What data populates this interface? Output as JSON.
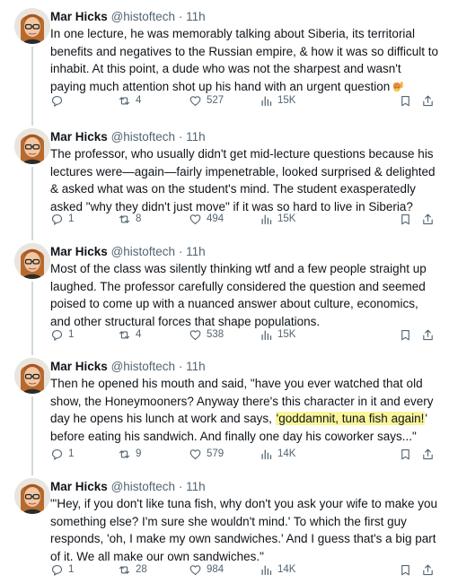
{
  "tweets": [
    {
      "author": {
        "name": "Mar Hicks",
        "handle": "@histoftech",
        "separator": "·",
        "time": "11h"
      },
      "text_parts": [
        "In one lecture, he was memorably talking about Siberia, its territorial benefits and negatives to the Russian empire, & how it was so difficult to inhabit. At this point, a dude who was not the sharpest and wasn't paying much attention shot up his hand with an urgent question"
      ],
      "emoji": "raising-hand-emoji",
      "stats": {
        "replies": "",
        "retweets": "4",
        "likes": "527",
        "views": "15K"
      }
    },
    {
      "author": {
        "name": "Mar Hicks",
        "handle": "@histoftech",
        "separator": "·",
        "time": "11h"
      },
      "text_parts": [
        "The professor, who usually didn't get mid-lecture questions because his lectures were—again—fairly impenetrable, looked surprised & delighted & asked what was on the student's mind. The student exasperatedly asked \"why they didn't just move\" if it was so hard to live in Siberia?"
      ],
      "stats": {
        "replies": "1",
        "retweets": "8",
        "likes": "494",
        "views": "15K"
      }
    },
    {
      "author": {
        "name": "Mar Hicks",
        "handle": "@histoftech",
        "separator": "·",
        "time": "11h"
      },
      "text_parts": [
        "Most of the class was silently thinking wtf and a few people straight up laughed. The professor carefully considered the question and seemed poised to come up with a nuanced answer about culture, economics, and other structural forces that shape populations."
      ],
      "stats": {
        "replies": "1",
        "retweets": "4",
        "likes": "538",
        "views": "15K"
      }
    },
    {
      "author": {
        "name": "Mar Hicks",
        "handle": "@histoftech",
        "separator": "·",
        "time": "11h"
      },
      "text_parts": [
        "Then he opened his mouth and said, \"have you ever watched that old show, the Honeymooners? Anyway there's this character in it and every day he opens his lunch at work and says, ",
        "'goddamnit, tuna fish again!",
        "' before eating his sandwich. And finally one day his coworker says...\""
      ],
      "stats": {
        "replies": "1",
        "retweets": "9",
        "likes": "579",
        "views": "14K"
      }
    },
    {
      "author": {
        "name": "Mar Hicks",
        "handle": "@histoftech",
        "separator": "·",
        "time": "11h"
      },
      "text_parts": [
        "\"'Hey, if you don't like tuna fish, why don't you ask your wife to make you something else? I'm sure she wouldn't mind.' To which the first guy responds, 'oh, I make my own sandwiches.' And I guess that's a big part of it. We all make our own sandwiches.\""
      ],
      "stats": {
        "replies": "1",
        "retweets": "28",
        "likes": "984",
        "views": "14K"
      }
    }
  ],
  "icons": {
    "reply": "reply-icon",
    "retweet": "retweet-icon",
    "like": "heart-icon",
    "views": "views-icon",
    "bookmark": "bookmark-icon",
    "share": "share-icon"
  },
  "colors": {
    "text": "#0f1419",
    "secondary": "#536471",
    "thread_line": "#cfd9de",
    "highlight": "#fbf59b"
  }
}
